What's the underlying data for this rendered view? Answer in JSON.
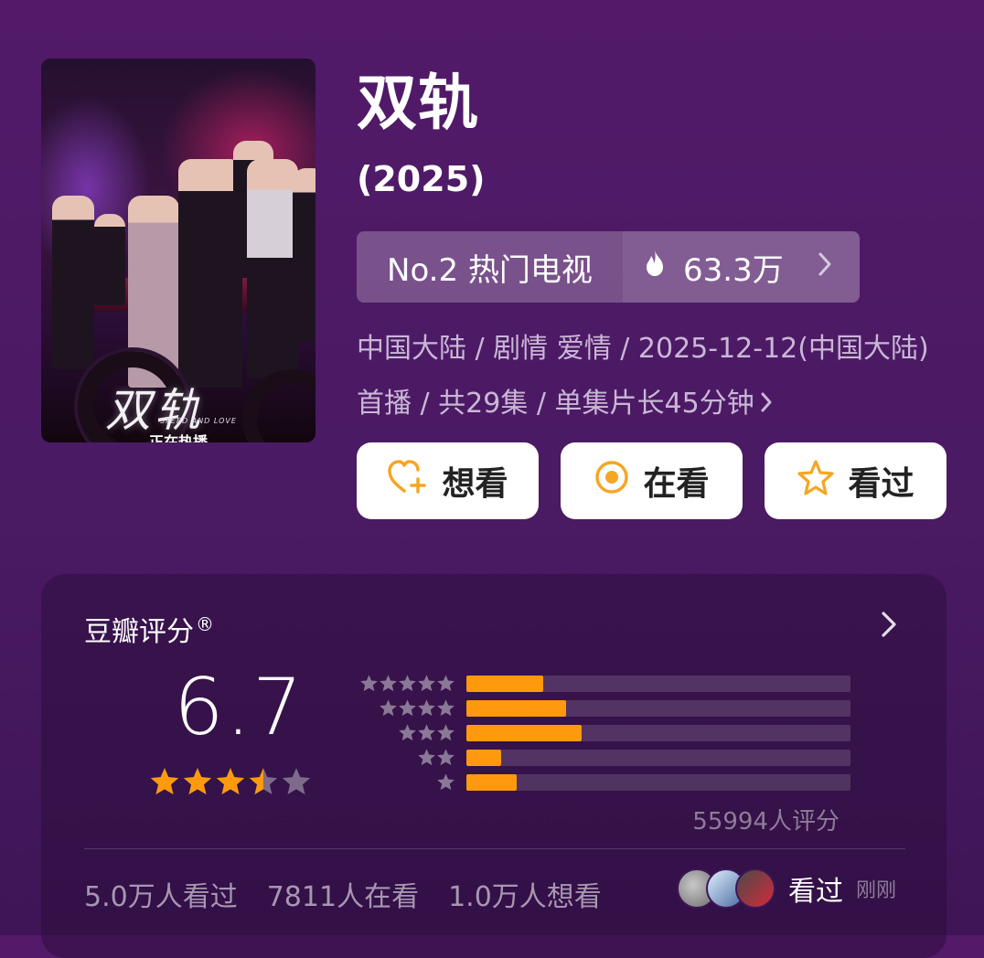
{
  "show": {
    "title": "双轨",
    "year": "(2025)",
    "poster": {
      "title_art": "双轨",
      "subtitle": "SPEED AND LOVE",
      "status": "正在热播"
    }
  },
  "rank": {
    "label": "No.2 热门电视",
    "heat": "63.3万",
    "icons": {
      "heat": "flame-icon",
      "more": "chevron-right-icon"
    }
  },
  "meta": {
    "text": "中国大陆 / 剧情 爱情 / 2025-12-12(中国大陆)首播 / 共29集 / 单集片长45分钟",
    "icon": "chevron-right-icon"
  },
  "actions": [
    {
      "label": "想看",
      "icon": "heart-plus-icon"
    },
    {
      "label": "在看",
      "icon": "target-icon"
    },
    {
      "label": "看过",
      "icon": "star-outline-icon"
    }
  ],
  "rating": {
    "title": "豆瓣评分",
    "title_mark": "®",
    "score": "6.7",
    "score_stars": 3.5,
    "distribution": [
      {
        "stars": 5,
        "fraction": 0.2
      },
      {
        "stars": 4,
        "fraction": 0.26
      },
      {
        "stars": 3,
        "fraction": 0.3
      },
      {
        "stars": 2,
        "fraction": 0.09
      },
      {
        "stars": 1,
        "fraction": 0.13
      }
    ],
    "count": "55994人评分",
    "accent_color": "#ff9a0e"
  },
  "stats": {
    "watched": "5.0万人看过",
    "watching": "7811人在看",
    "want": "1.0万人想看"
  },
  "recent": {
    "action": "看过",
    "time": "刚刚"
  }
}
